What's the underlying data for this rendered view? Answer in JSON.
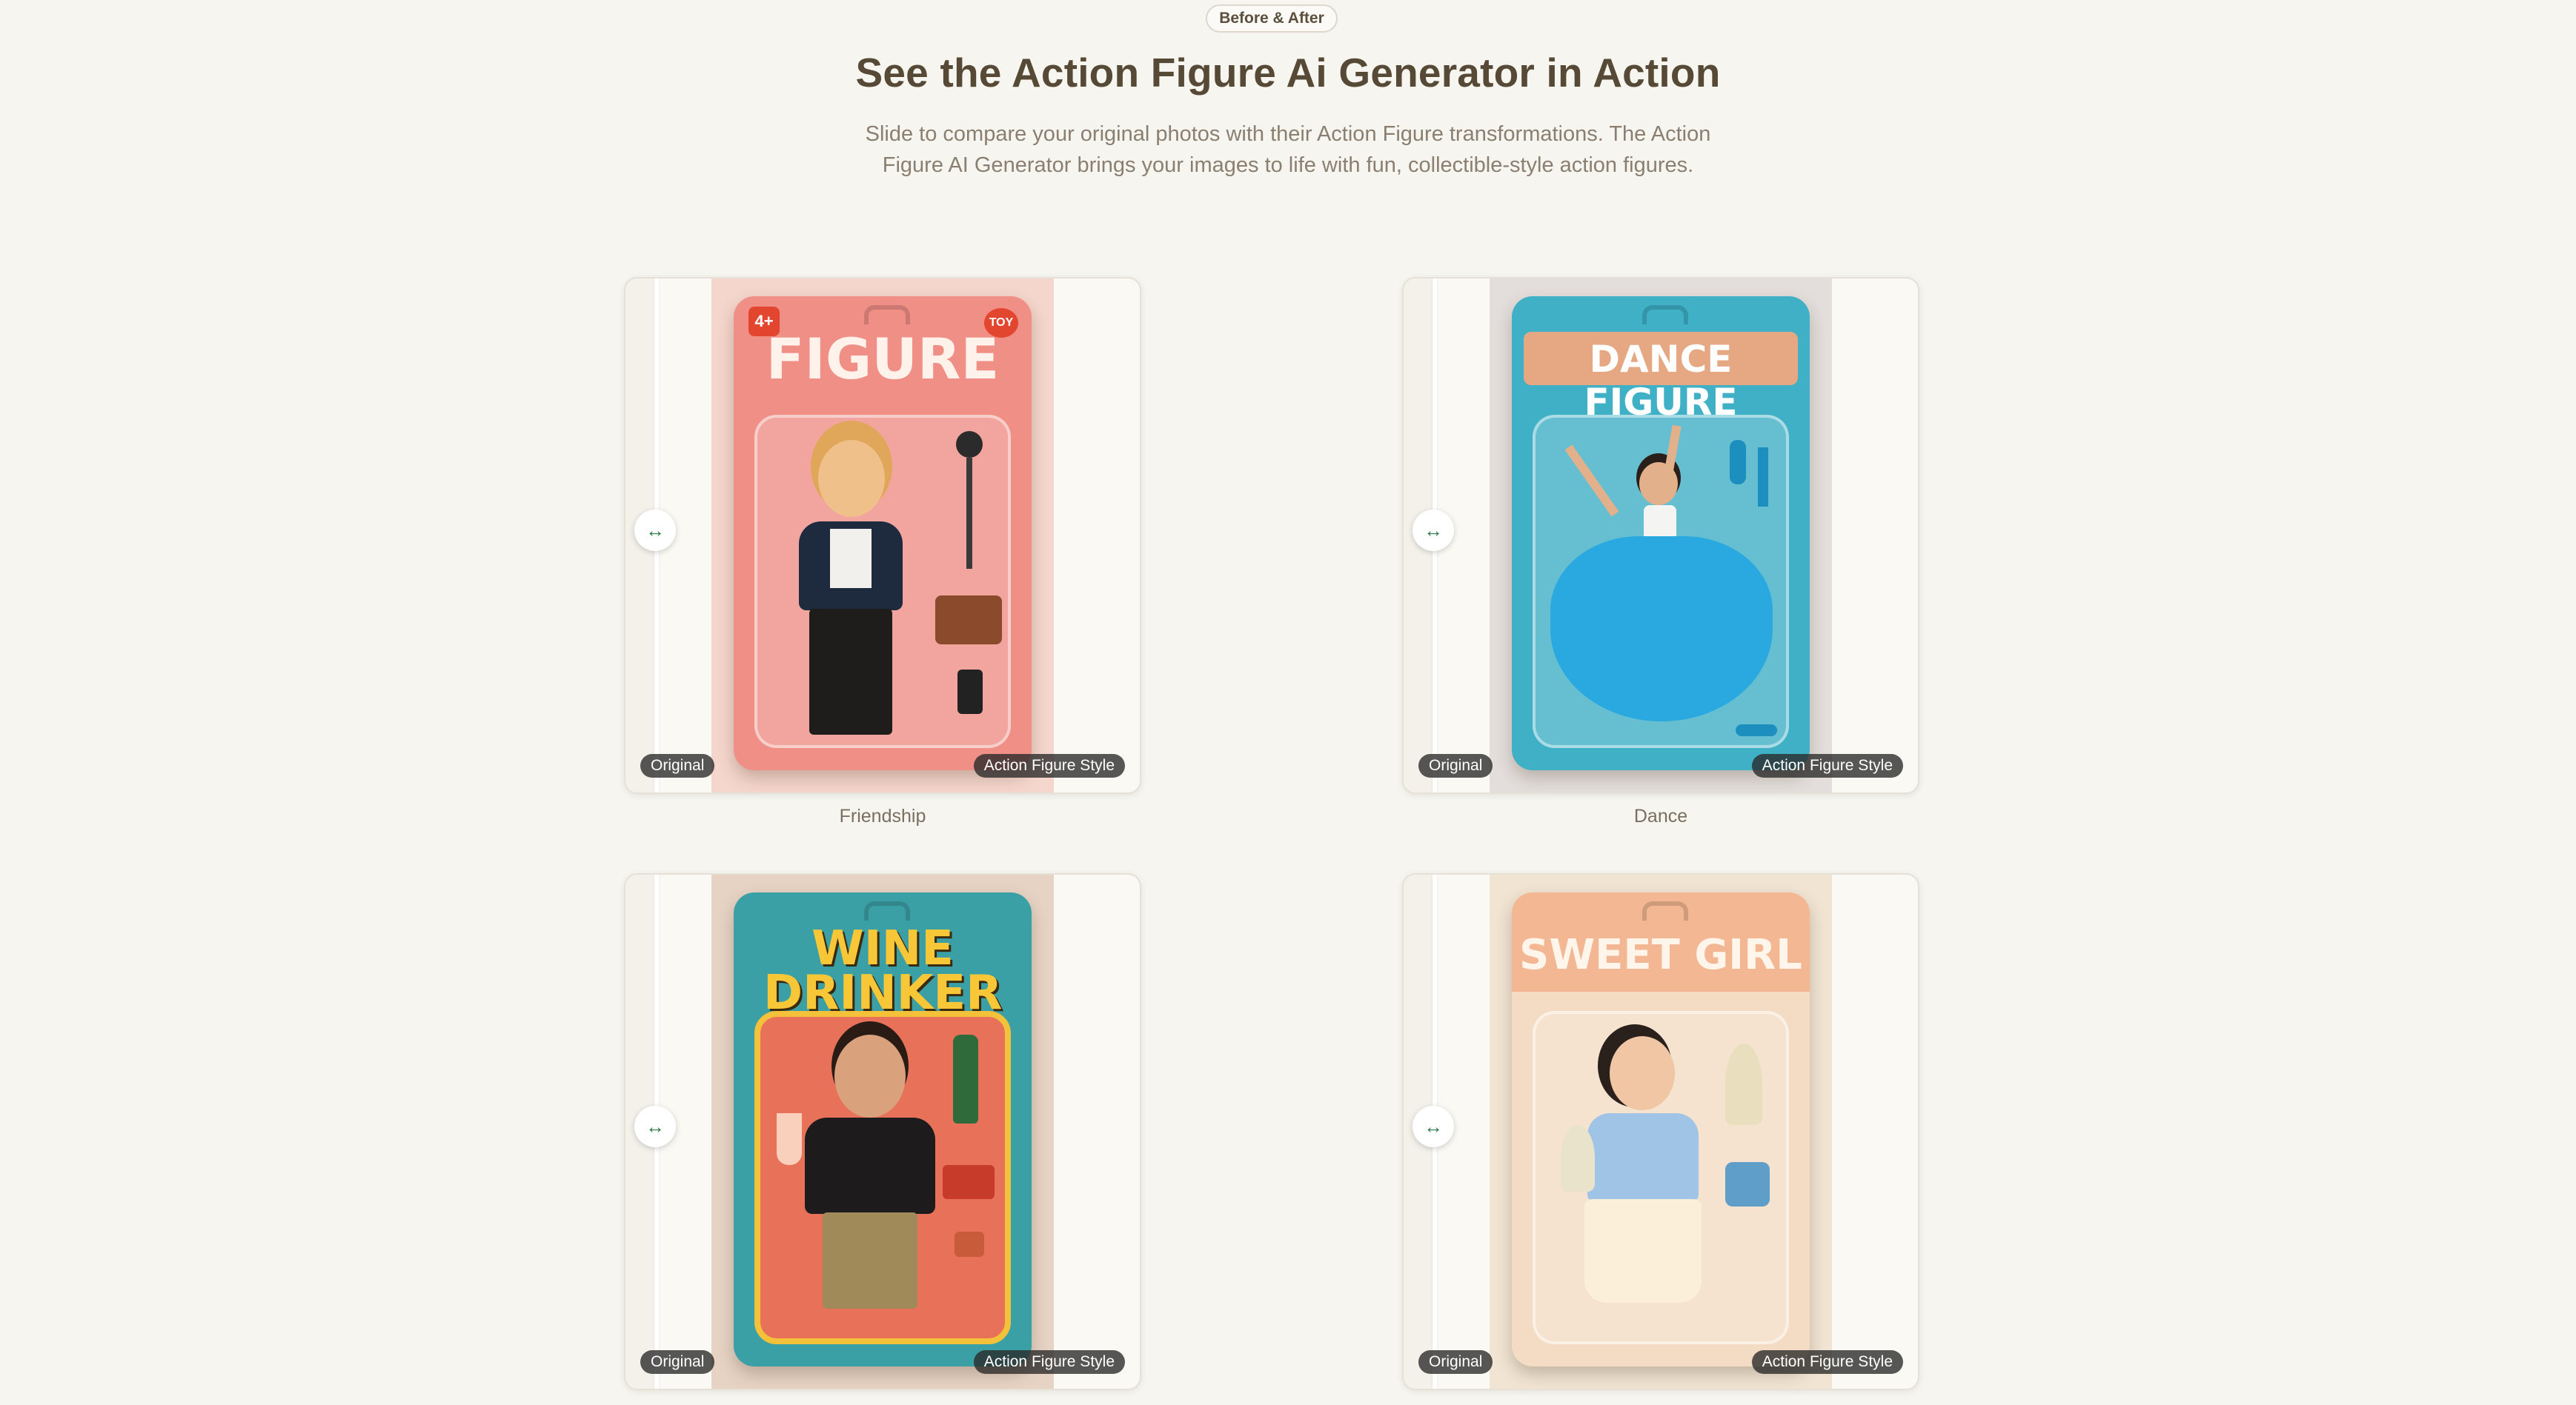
{
  "header": {
    "badge": "Before & After",
    "title": "See the Action Figure Ai Generator in Action",
    "subtitle": "Slide to compare your original photos with their Action Figure transformations. The Action Figure AI Generator brings your images to life with fun, collectible-style action figures."
  },
  "labels": {
    "original": "Original",
    "styled": "Action Figure Style",
    "handle_icon": "↔"
  },
  "cards": [
    {
      "caption": "Friendship",
      "package_title": "FIGURE",
      "package_color": "#ef8f86",
      "bg_color": "#f5d6cc",
      "tag_left": "4+",
      "tag_right": "TOY"
    },
    {
      "caption": "Dance",
      "package_title": "DANCE FIGURE",
      "package_color": "#3fb0c6",
      "bg_color": "#e3dedb",
      "tag_left": "",
      "tag_right": ""
    },
    {
      "caption": "",
      "package_title": "WINE DRINKER",
      "package_color": "#3b9fa6",
      "bg_color": "#e7d3c4",
      "tag_left": "",
      "tag_right": ""
    },
    {
      "caption": "",
      "package_title": "SWEET GIRL",
      "package_color": "#f3b893",
      "bg_color": "#f1e4d2",
      "tag_left": "",
      "tag_right": ""
    }
  ]
}
